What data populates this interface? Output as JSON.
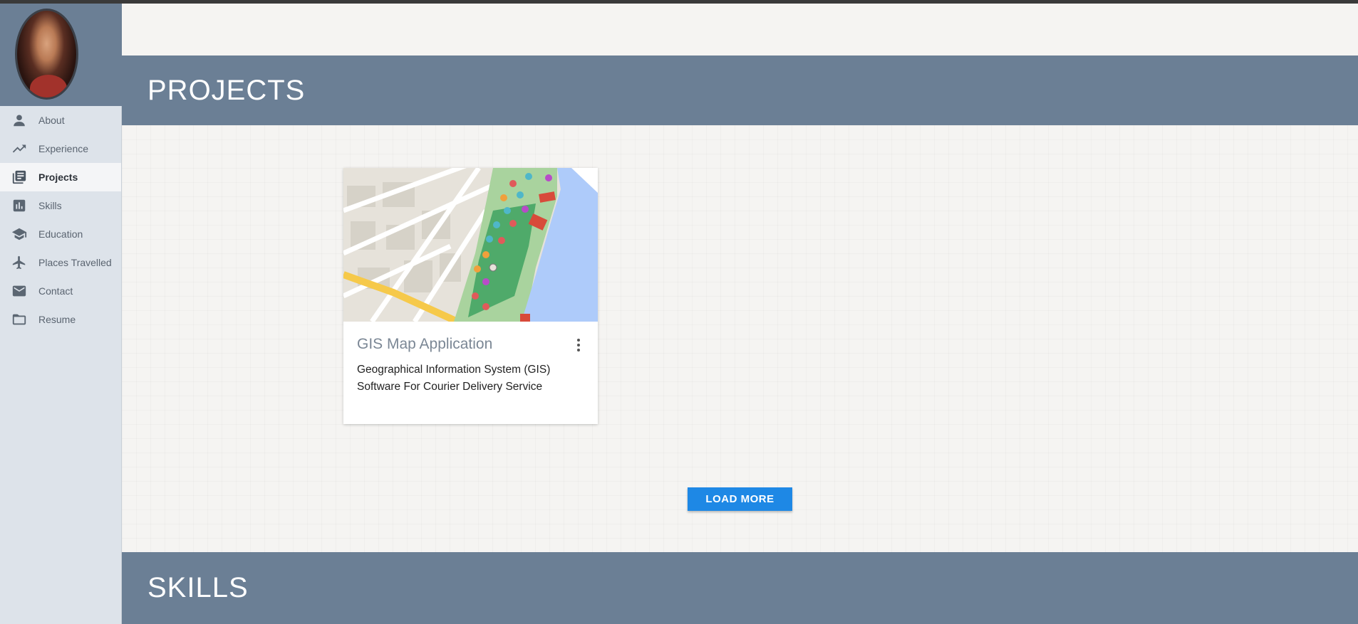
{
  "sidebar": {
    "items": [
      {
        "label": "About",
        "icon": "person-icon"
      },
      {
        "label": "Experience",
        "icon": "trending-up-icon"
      },
      {
        "label": "Projects",
        "icon": "library-books-icon",
        "active": true
      },
      {
        "label": "Skills",
        "icon": "bar-chart-icon"
      },
      {
        "label": "Education",
        "icon": "graduation-cap-icon"
      },
      {
        "label": "Places Travelled",
        "icon": "airplane-icon"
      },
      {
        "label": "Contact",
        "icon": "mail-icon"
      },
      {
        "label": "Resume",
        "icon": "folder-icon"
      }
    ]
  },
  "projects": {
    "heading": "PROJECTS",
    "cards": [
      {
        "title": "GIS Map Application",
        "description": "Geographical Information System (GIS) Software For Courier Delivery Service"
      }
    ],
    "load_more_label": "LOAD MORE"
  },
  "skills": {
    "heading": "SKILLS"
  },
  "colors": {
    "section_bar": "#6b7f95",
    "sidebar_bg": "#dde3ea",
    "button": "#1e88e5"
  }
}
